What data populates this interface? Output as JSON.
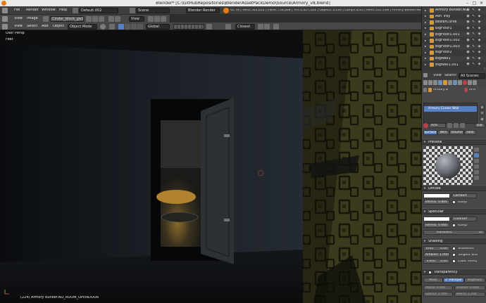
{
  "window": {
    "title": "Blender* [C:\\GitHubRepositories\\BlenderAssetPackDemo\\Source\\Armory_v8.blend]",
    "minimize": "–",
    "maximize": "□",
    "close": "✕"
  },
  "info_header": {
    "menus": [
      "File",
      "Render",
      "Window",
      "Help"
    ],
    "layout": "Default.002",
    "scene": "Scene",
    "render_engine": "Blender Render",
    "stats": "v2.78 | Verts:542,422 | Faces:756,268 | Tris:1,027,324 | Objects:1/126 | Lamps:0/10 | Mem:510.13M | Armory Bunker.NO_ROOM_OPENDOOR"
  },
  "image_header": {
    "menus": [
      "View",
      "Image"
    ],
    "image_name": "Cinder_block_gw12",
    "view": "View"
  },
  "view3d_header": {
    "menus": [
      "View",
      "Select",
      "Add",
      "Object"
    ],
    "mode": "Object Mode",
    "pivot": "Global",
    "snap": "Closest"
  },
  "viewport": {
    "overlay_view": "User Persp",
    "overlay_units": "Feet",
    "status": "(224) Armory Bunker.NO_ROOM_OPENDOOR"
  },
  "outliner": {
    "items": [
      {
        "label": "Armory Bunker.NO"
      },
      {
        "label": "Ash Tray"
      },
      {
        "label": "BezierCurve"
      },
      {
        "label": "BigFloor1"
      },
      {
        "label": "BigFloor1.001"
      },
      {
        "label": "BigFloor1.002"
      },
      {
        "label": "BigFloor1.003"
      },
      {
        "label": "BigFloor2"
      },
      {
        "label": "BigWall1"
      },
      {
        "label": "BigWall1.001"
      }
    ]
  },
  "properties": {
    "search_menus": [
      "View",
      "Search"
    ],
    "scene_filter": "All Scenes",
    "breadcrumb_object": "Armory B",
    "breadcrumb_material": "Arm",
    "material_slot": "Armory Cinder Wall",
    "material_name": "Arm",
    "data_btn": "Dat",
    "tabs": [
      "Surface",
      "Wire",
      "Volume",
      "Halo"
    ],
    "active_tab": "Surface",
    "sections": {
      "preview": "Preview",
      "diffuse": "Diffuse",
      "specular": "Specular",
      "shading": "Shading",
      "transparency": "Transparency"
    },
    "diffuse": {
      "shader": "Lambert",
      "intensity": "Intensi: 0.800",
      "ramp": "Ramp"
    },
    "specular": {
      "shader": "CookTorr",
      "intensity": "Intensi: 0.000",
      "ramp": "Ramp",
      "hardness_label": "Hardness:",
      "hardness": "50"
    },
    "shading": {
      "emit": "Emit:",
      "emit_val": "0.00",
      "ambient": "Ambien: 1.000",
      "transl": "Transl:",
      "transl_val": "0.00",
      "shadeless": "Shadeless",
      "tangent": "Tangent Sha",
      "cubic": "Cubic Interp"
    },
    "transparency": {
      "modes": [
        "Mask",
        "Z Transpar",
        "Raytrace"
      ],
      "alpha": "Alpha: 0.000",
      "fresnel": "Fresnel: 0.000",
      "specul": "Specul: 1.000",
      "blend": "Blend: 1.250"
    }
  },
  "colors": {
    "accent_blue": "#5680c2",
    "object_orange": "#d59a3c",
    "panel_bg": "#484848",
    "header_bg": "#474747"
  }
}
